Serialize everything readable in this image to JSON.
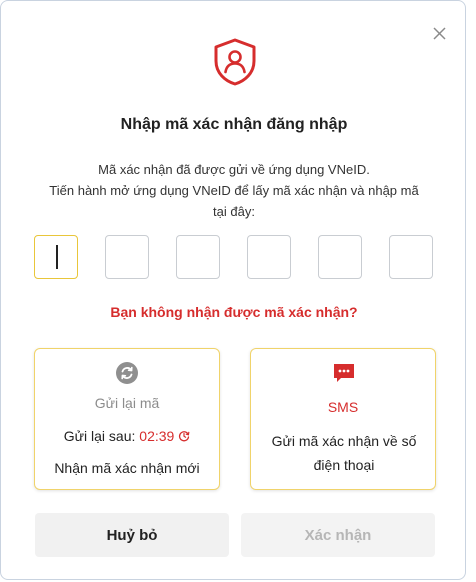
{
  "dialog": {
    "title": "Nhập mã xác nhận đăng nhập",
    "description_line1": "Mã xác nhận đã được gửi về ứng dụng VNeID.",
    "description_line2": "Tiến hành mở ứng dụng VNeID để lấy mã xác nhận và nhập mã tại đây:",
    "otp_digits": [
      "",
      "",
      "",
      "",
      "",
      ""
    ],
    "question": "Bạn không nhận được mã xác nhận?",
    "accent_color": "#d62d2d",
    "highlight_color": "#e9c63a"
  },
  "resend_card": {
    "icon": "refresh-icon",
    "title": "Gửi lại mã",
    "countdown_label": "Gửi lại sau:",
    "countdown_value": "02:39",
    "countdown_icon": "clock-icon",
    "subtitle": "Nhận mã xác nhận mới"
  },
  "sms_card": {
    "icon": "sms-message-icon",
    "title": "SMS",
    "description": "Gửi mã xác nhận về số điện thoại"
  },
  "buttons": {
    "cancel_label": "Huỷ bỏ",
    "confirm_label": "Xác nhận"
  },
  "icons": {
    "close": "close-icon",
    "header": "user-shield-icon"
  }
}
